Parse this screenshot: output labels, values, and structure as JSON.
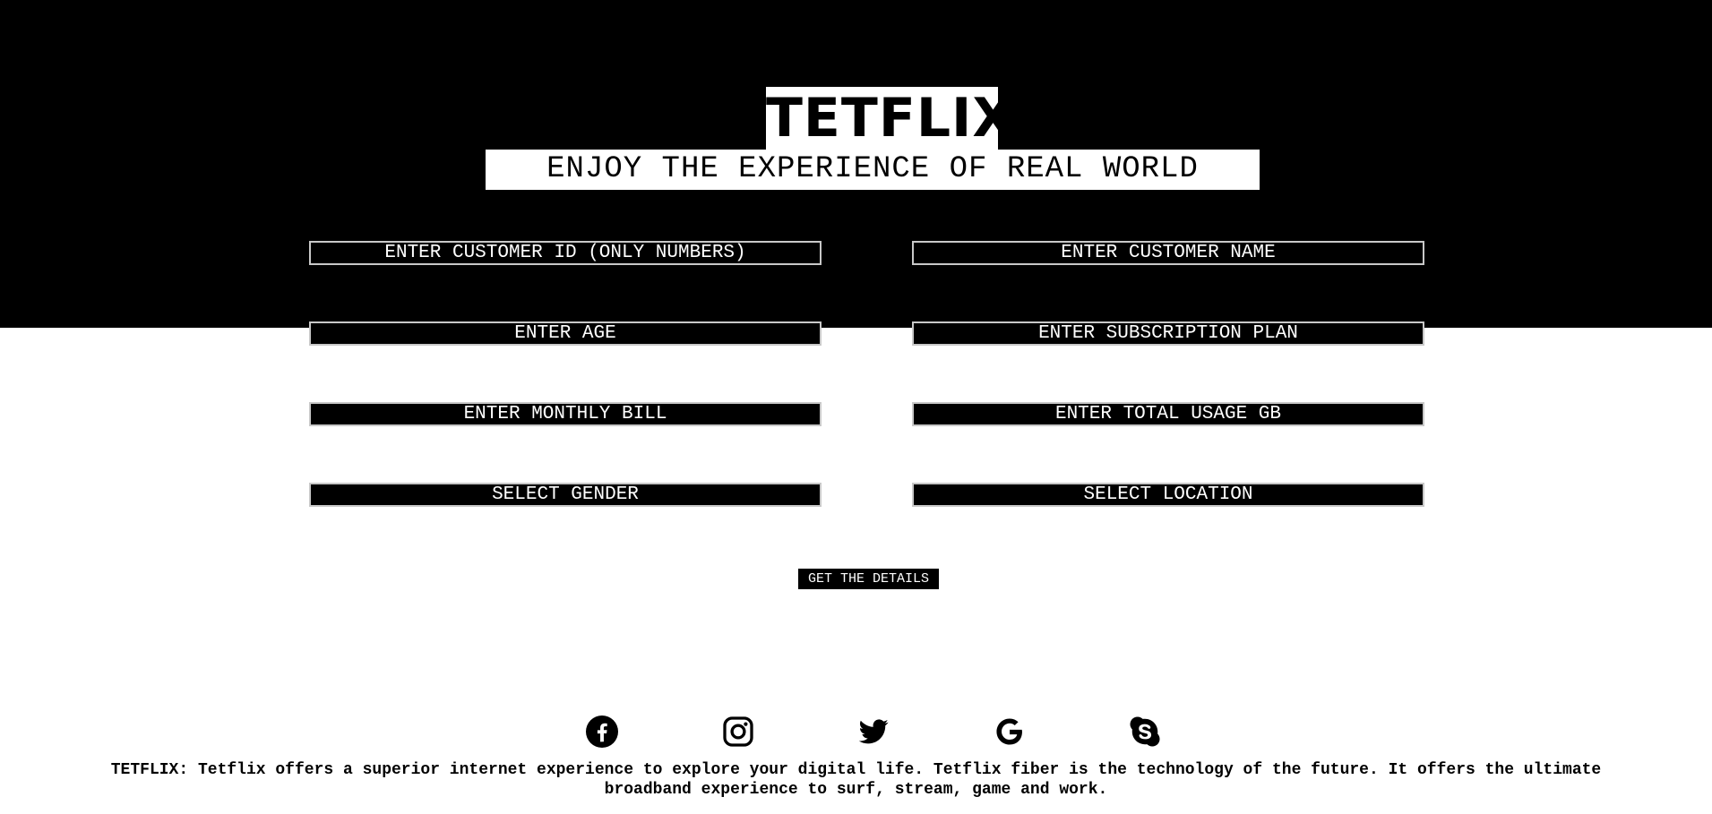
{
  "header": {
    "brand": "TETFLIX",
    "tagline": "ENJOY THE EXPERIENCE OF REAL WORLD",
    "background_color": "#000000"
  },
  "form": {
    "fields": {
      "customer_id": {
        "placeholder": "ENTER CUSTOMER ID (ONLY NUMBERS)"
      },
      "customer_name": {
        "placeholder": "ENTER CUSTOMER NAME"
      },
      "age": {
        "placeholder": "ENTER AGE"
      },
      "subscription_plan": {
        "placeholder": "ENTER SUBSCRIPTION PLAN"
      },
      "monthly_bill": {
        "placeholder": "ENTER MONTHLY BILL"
      },
      "total_usage_gb": {
        "placeholder": "ENTER TOTAL USAGE GB"
      },
      "gender": {
        "selected": "SELECT GENDER"
      },
      "location": {
        "selected": "SELECT LOCATION"
      }
    },
    "submit_label": "GET THE DETAILS"
  },
  "social": {
    "icons": [
      "facebook-icon",
      "instagram-icon",
      "twitter-icon",
      "google-icon",
      "skype-icon"
    ]
  },
  "footer": {
    "text": "TETFLIX: Tetflix offers a superior internet experience to explore your digital life. Tetflix fiber is the technology of the future. It offers the ultimate broadband experience to surf, stream, game and work."
  }
}
